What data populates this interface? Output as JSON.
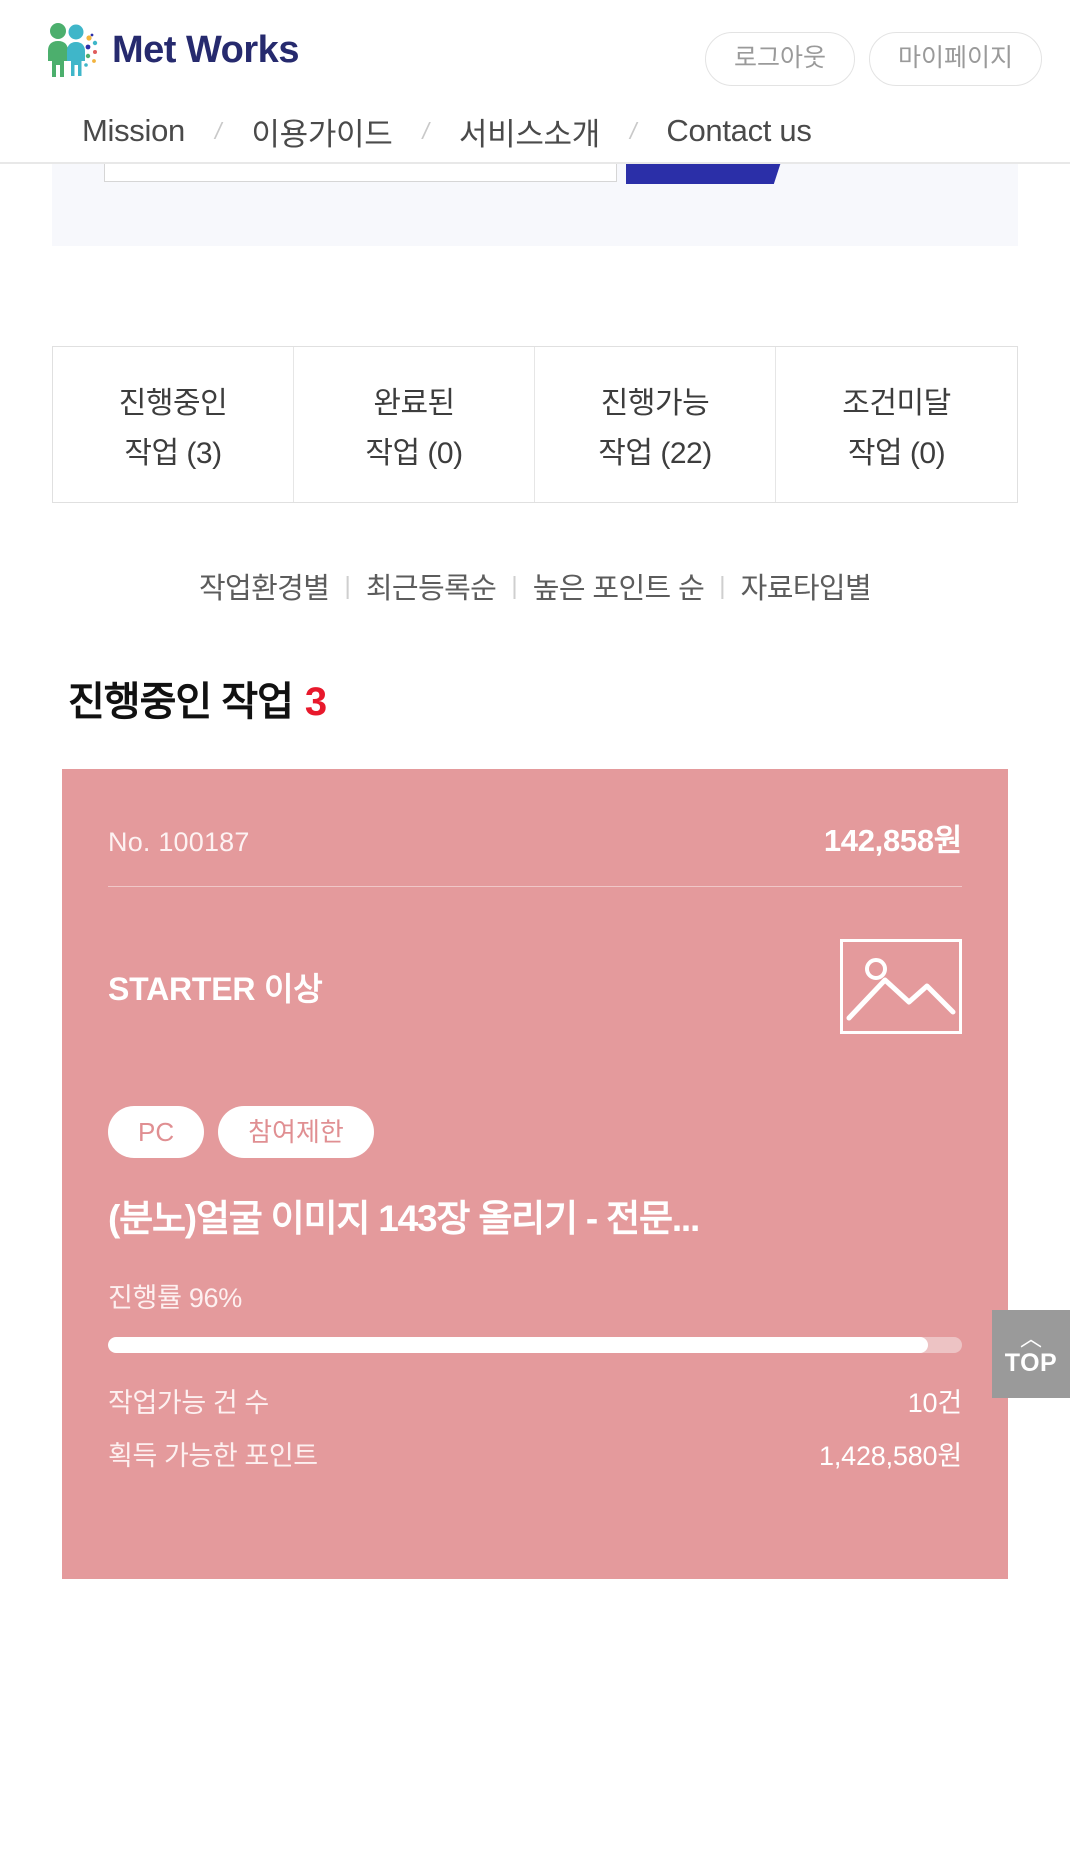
{
  "header": {
    "brand_name": "Met Works",
    "brand_logo_icon": "two-people-logo-icon",
    "actions": [
      {
        "label": "로그아웃",
        "name": "logout-button"
      },
      {
        "label": "마이페이지",
        "name": "mypage-button"
      }
    ],
    "nav": [
      {
        "label": "Mission"
      },
      {
        "label": "이용가이드"
      },
      {
        "label": "서비스소개"
      },
      {
        "label": "Contact us"
      }
    ],
    "nav_separator": "/"
  },
  "tabs": [
    {
      "line1": "진행중인",
      "line2": "작업 (3)"
    },
    {
      "line1": "완료된",
      "line2": "작업 (0)"
    },
    {
      "line1": "진행가능",
      "line2": "작업 (22)"
    },
    {
      "line1": "조건미달",
      "line2": "작업 (0)"
    }
  ],
  "sort": {
    "divider": "|",
    "options": [
      {
        "label": "작업환경별"
      },
      {
        "label": "최근등록순"
      },
      {
        "label": "높은 포인트 순"
      },
      {
        "label": "자료타입별"
      }
    ]
  },
  "section": {
    "title": "진행중인 작업",
    "count": "3"
  },
  "card": {
    "no": "No. 100187",
    "price": "142,858원",
    "grade": "STARTER 이상",
    "thumbnail_icon": "image-placeholder-icon",
    "badges": [
      {
        "label": "PC"
      },
      {
        "label": "참여제한"
      }
    ],
    "title": "(분노)얼굴 이미지 143장 올리기 - 전문...",
    "progress_label": "진행률 96%",
    "progress_percent": 96,
    "stats": [
      {
        "key": "작업가능 건 수",
        "value": "10건"
      },
      {
        "key": "획득 가능한 포인트",
        "value": "1,428,580원"
      }
    ]
  },
  "top_button": {
    "caret": "︿",
    "label": "TOP"
  },
  "colors": {
    "brand_navy": "#262a6e",
    "card_pink": "#e49a9c",
    "accent_red": "#e8192c",
    "submit_blue": "#2b2fa8"
  }
}
